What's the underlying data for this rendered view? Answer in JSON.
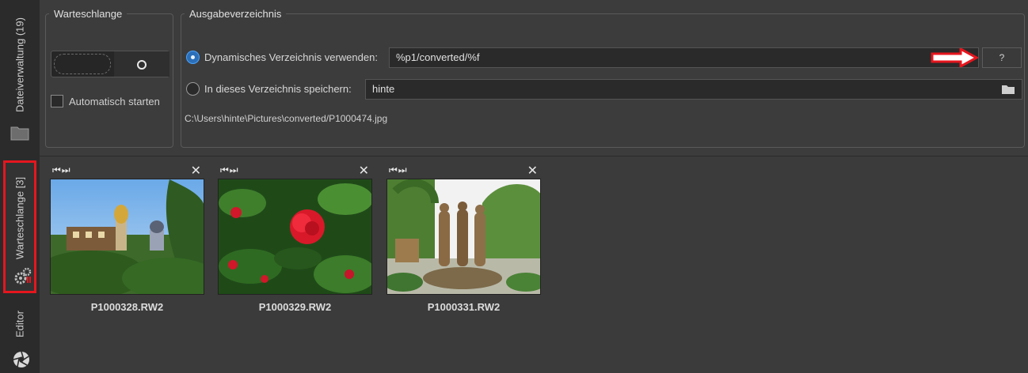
{
  "sidebar": {
    "tabs": [
      {
        "label": "Dateiverwaltung (19)",
        "icon": "folder-icon"
      },
      {
        "label": "Warteschlange [3]",
        "icon": "gears-icon",
        "highlighted": true
      },
      {
        "label": "Editor",
        "icon": "aperture-icon"
      }
    ]
  },
  "queue_group": {
    "title": "Warteschlange",
    "autostart_label": "Automatisch starten"
  },
  "output_group": {
    "title": "Ausgabeverzeichnis",
    "dynamic_label": "Dynamisches Verzeichnis verwenden:",
    "dynamic_value": "%p1/converted/%f",
    "help_label": "?",
    "fixed_label": "In dieses Verzeichnis speichern:",
    "fixed_value": "hinte",
    "path_preview": "C:\\Users\\hinte\\Pictures\\converted/P1000474.jpg"
  },
  "queue": {
    "items": [
      {
        "name": "P1000328.RW2",
        "nav": "⏮⏭",
        "close": "✕"
      },
      {
        "name": "P1000329.RW2",
        "nav": "⏮⏭",
        "close": "✕"
      },
      {
        "name": "P1000331.RW2",
        "nav": "⏮⏭",
        "close": "✕"
      }
    ]
  },
  "colors": {
    "highlight": "#e5161e",
    "accent": "#2b6fb8"
  }
}
